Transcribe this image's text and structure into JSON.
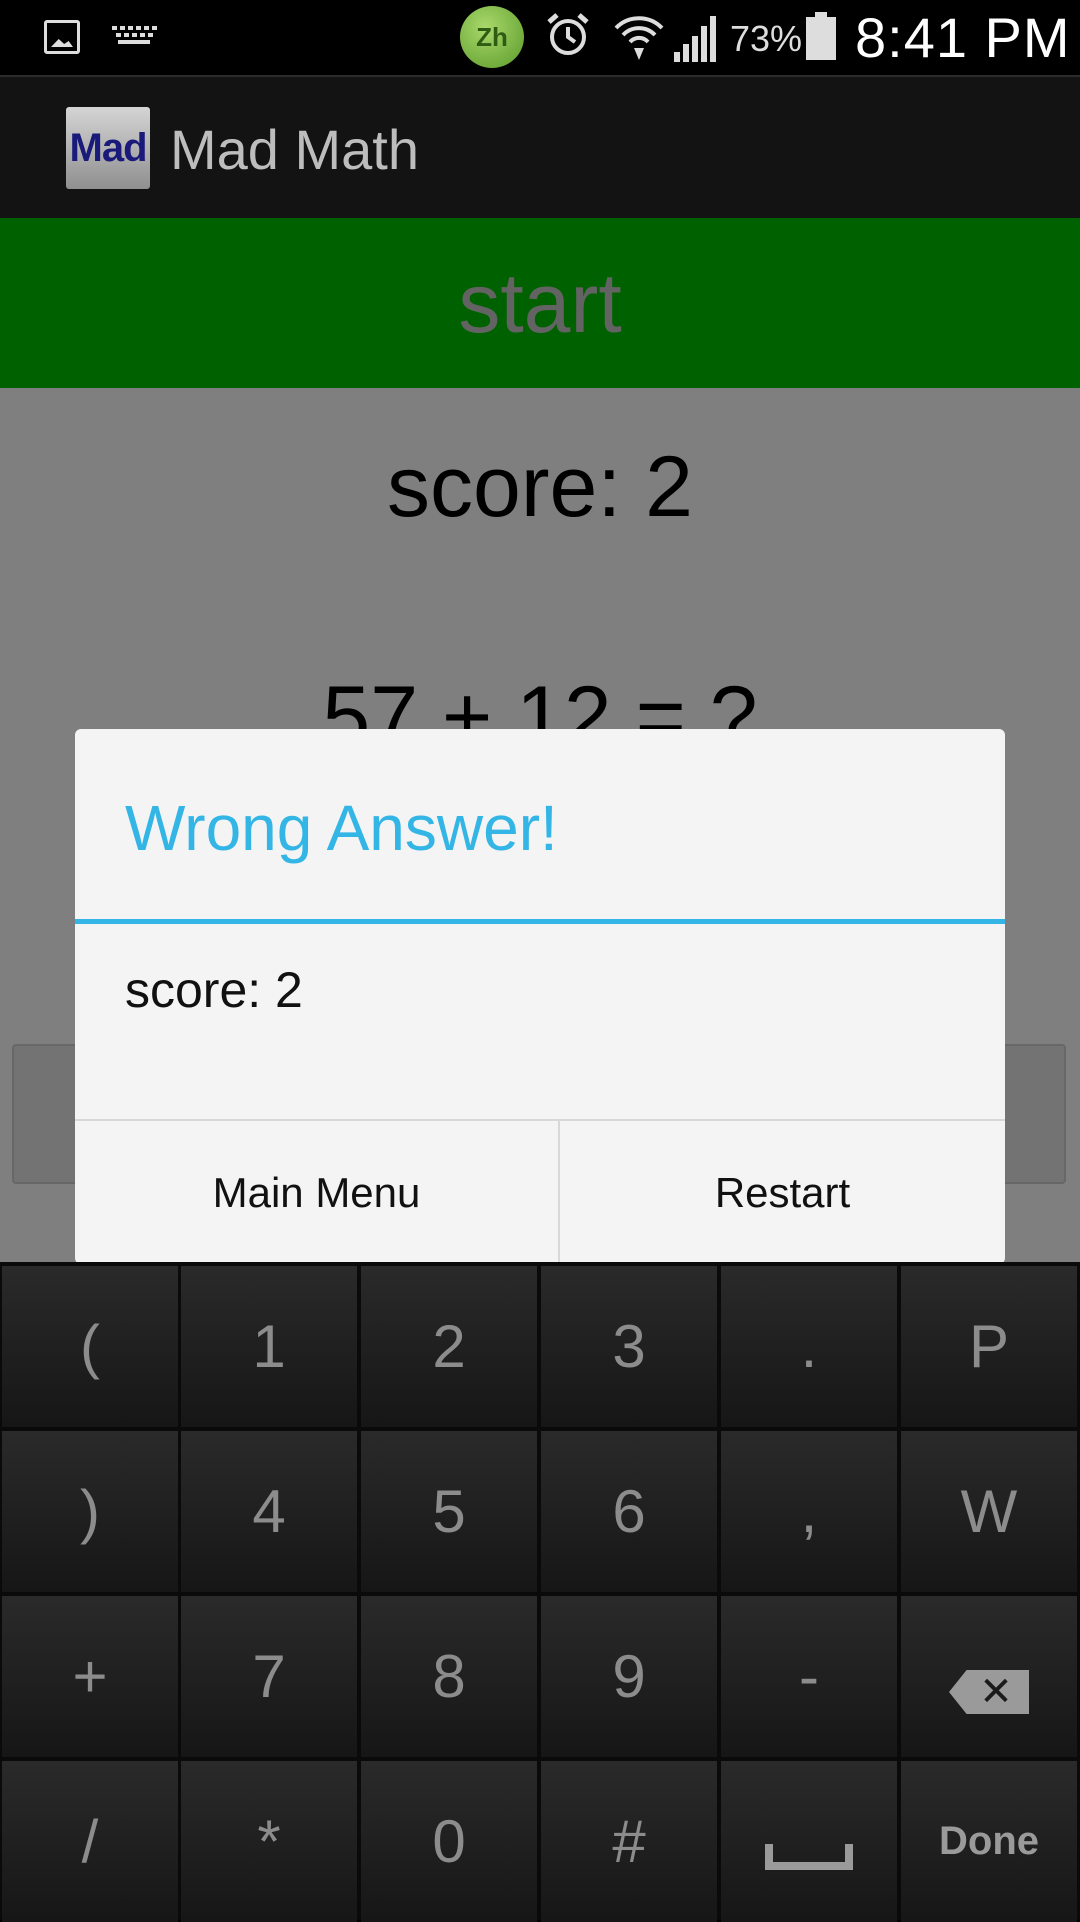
{
  "status_bar": {
    "battery_percent": "73%",
    "time": "8:41 PM",
    "input_method_badge": "Zh",
    "icons": [
      "gallery-icon",
      "keyboard-icon",
      "input-method-icon",
      "alarm-icon",
      "wifi-icon",
      "signal-icon",
      "battery-icon"
    ]
  },
  "action_bar": {
    "app_icon_text": "Mad",
    "title": "Mad Math"
  },
  "main": {
    "start_label": "start",
    "score_label": "score: 2",
    "equation": "57 + 12 = ?",
    "start_bar_color": "#00c300"
  },
  "dialog": {
    "title": "Wrong Answer!",
    "message": "score: 2",
    "accent_color": "#33b5e5",
    "buttons": {
      "left": "Main Menu",
      "right": "Restart"
    }
  },
  "keyboard": {
    "keys": {
      "r0": [
        "(",
        "1",
        "2",
        "3",
        ".",
        "P"
      ],
      "r1": [
        ")",
        "4",
        "5",
        "6",
        ",",
        "W"
      ],
      "r2": [
        "+",
        "7",
        "8",
        "9",
        "-",
        "backspace"
      ],
      "r3": [
        "/",
        "*",
        "0",
        "#",
        "space",
        "Done"
      ]
    },
    "backspace_glyph": "✕"
  }
}
